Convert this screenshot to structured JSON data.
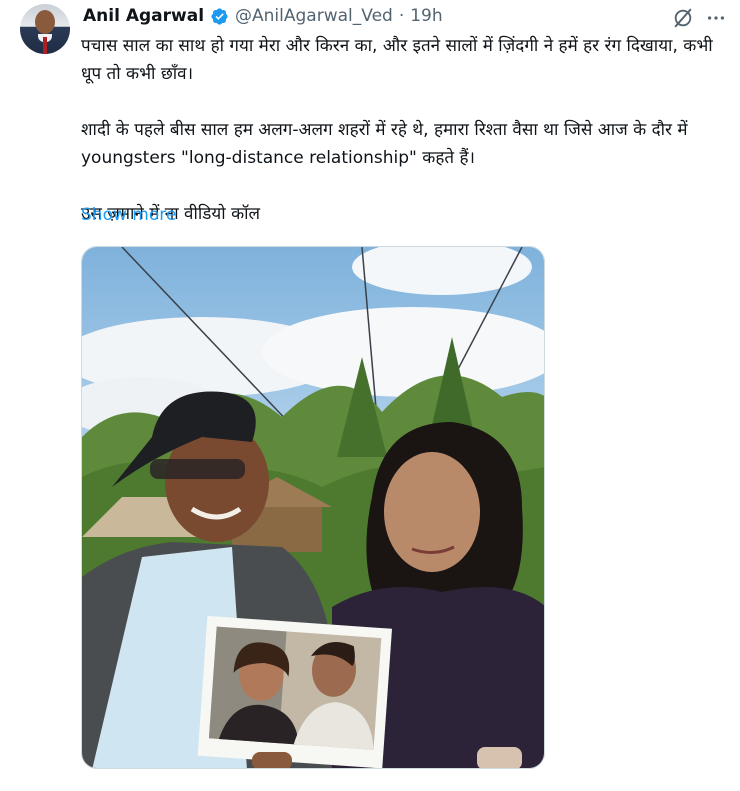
{
  "author": {
    "name": "Anil Agarwal",
    "handle": "@AnilAgarwal_Ved",
    "separator": "·",
    "time": "19h",
    "verified": true,
    "badge_color": "#1d9bf0"
  },
  "post": {
    "paragraphs": [
      "पचास साल का साथ हो गया मेरा और किरन का, और इतने सालों में ज़िंदगी ने हमें हर रंग दिखाया, कभी धूप तो कभी छाँव।",
      "शादी के पहले बीस साल हम अलग-अलग शहरों में रहे थे, हमारा रिश्ता वैसा था जिसे आज के दौर में youngsters \"long-distance relationship\" कहते हैं।",
      "उस ज़माने में ना वीडियो कॉल"
    ],
    "show_more": "Show more"
  },
  "icons": {
    "grok": "grok-icon",
    "more": "more-options-icon",
    "verified": "verified-badge-icon"
  },
  "colors": {
    "link": "#1d9bf0",
    "secondary_text": "#536471",
    "primary_text": "#0f1419"
  }
}
